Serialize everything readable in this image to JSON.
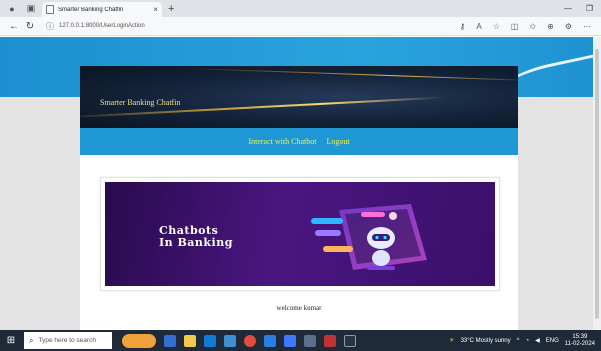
{
  "browser": {
    "tab_title": "Smarter Banking Chatfin",
    "tab_close": "×",
    "new_tab": "+",
    "url": "127.0.0.1:8000/UserLoginAction"
  },
  "site": {
    "title": "Smarter Banking Chatfin",
    "nav": [
      "Interact with Chatbot",
      "Logout"
    ],
    "banner_line1": "Chatbots",
    "banner_line2": "In Banking",
    "welcome": "welcome kumar"
  },
  "taskbar": {
    "search_placeholder": "Type here to search",
    "weather": "33°C  Mostly sunny",
    "lang": "ENG",
    "time": "15:39",
    "date": "11-02-2024"
  },
  "colors": {
    "nav_bg": "#1e98d4",
    "nav_text": "#f5f04a",
    "banner_bg": "#4a1680",
    "hero_bg": "#132238"
  }
}
